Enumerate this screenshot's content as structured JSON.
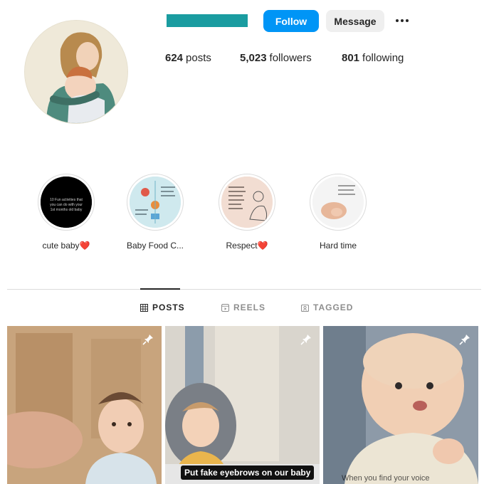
{
  "header": {
    "follow_label": "Follow",
    "message_label": "Message",
    "more_icon": "more-options-icon",
    "username_color": "#1a9ca0"
  },
  "stats": {
    "posts_count": "624",
    "posts_label": "posts",
    "followers_count": "5,023",
    "followers_label": "followers",
    "following_count": "801",
    "following_label": "following"
  },
  "highlights": [
    {
      "label": "cute baby❤️",
      "cover_text": "10 Fun activities that you can do with your 1st months old baby"
    },
    {
      "label": "Baby Food C..."
    },
    {
      "label": "Respect❤️"
    },
    {
      "label": "Hard time"
    }
  ],
  "tabs": [
    {
      "label": "POSTS",
      "icon": "grid-icon",
      "active": true
    },
    {
      "label": "REELS",
      "icon": "reels-icon",
      "active": false
    },
    {
      "label": "TAGGED",
      "icon": "tagged-icon",
      "active": false
    }
  ],
  "posts": [
    {
      "pinned": true
    },
    {
      "pinned": true,
      "caption": "Put fake eyebrows on our baby"
    },
    {
      "pinned": true,
      "caption": "When you find your voice"
    }
  ],
  "colors": {
    "accent": "#0095f6",
    "text": "#262626",
    "muted": "#8e8e8e",
    "divider": "#dbdbdb"
  }
}
